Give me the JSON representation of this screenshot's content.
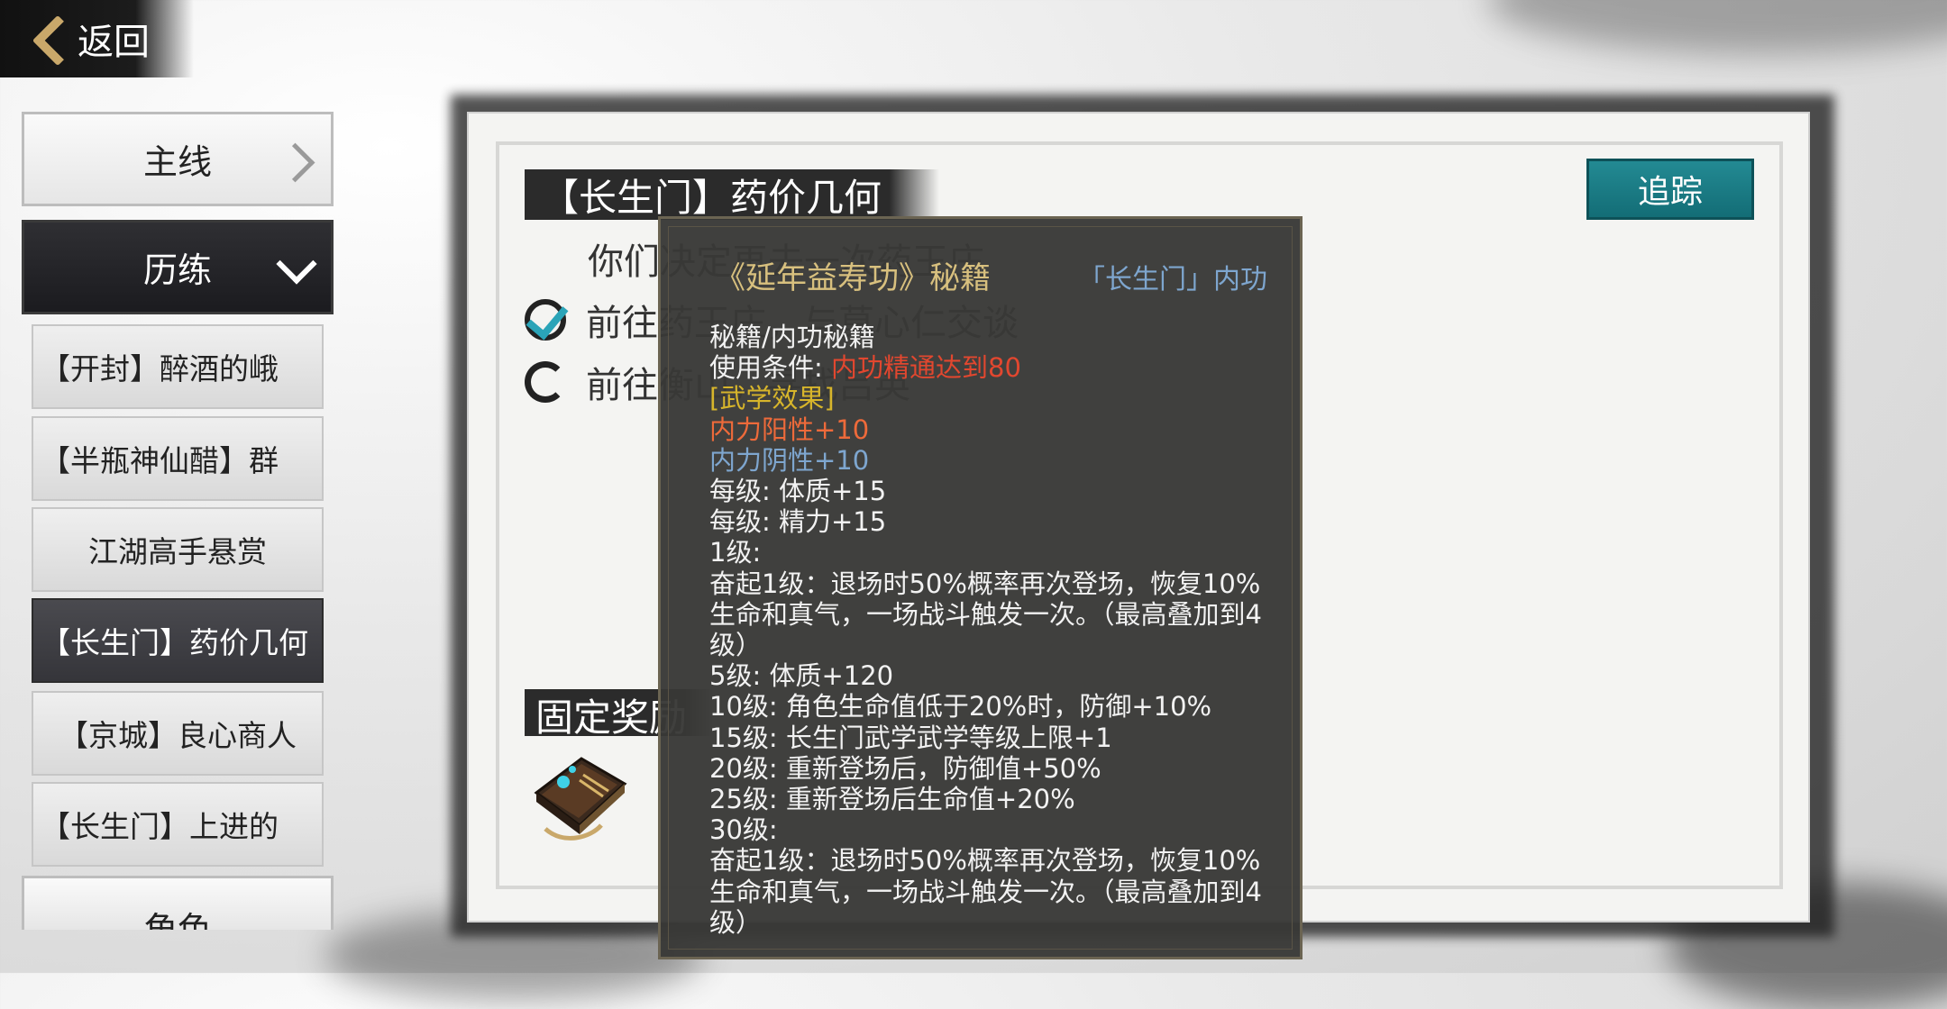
{
  "header": {
    "back_label": "返回"
  },
  "sidebar": {
    "main_line": "主线",
    "training": "历练",
    "quests": [
      "【开封】醉酒的峨",
      "【半瓶神仙醋】群",
      "江湖高手悬赏",
      "【长生门】药价几何",
      "【京城】良心商人",
      "【长生门】上进的"
    ],
    "role": "角色"
  },
  "quest": {
    "title": "【长生门】药价几何",
    "track_label": "追踪",
    "description": "你们决定再去一次药王庄",
    "objectives": [
      {
        "text": "前往药王庄，与莫心仁交谈",
        "done": true
      },
      {
        "text": "前往衡山，寻找吕英",
        "done": false
      }
    ],
    "reward_title": "固定奖励"
  },
  "tooltip": {
    "name": "《延年益寿功》秘籍",
    "type": "「长生门」内功",
    "category": "秘籍/内功秘籍",
    "condition_label": "使用条件: ",
    "condition_value": "内功精通达到80",
    "effect_header": "[武学效果]",
    "yang": "内力阳性+10",
    "yin": "内力阴性+10",
    "per_level_1": "每级: 体质+15",
    "per_level_2": "每级: 精力+15",
    "lv1": "1级:",
    "lv1_desc": "奋起1级：退场时50%概率再次登场，恢复10%生命和真气，一场战斗触发一次。（最高叠加到4级）",
    "lv5": "5级: 体质+120",
    "lv10": "10级: 角色生命值低于20%时，防御+10%",
    "lv15": "15级: 长生门武学武学等级上限+1",
    "lv20": "20级: 重新登场后，防御值+50%",
    "lv25": "25级: 重新登场后生命值+20%",
    "lv30": "30级:",
    "lv30_desc": "奋起1级：退场时50%概率再次登场，恢复10%生命和真气，一场战斗触发一次。（最高叠加到4级）"
  },
  "colors": {
    "accent_teal": "#1d7f89",
    "tooltip_title": "#d8c07e",
    "condition_red": "#e2472f",
    "effect_yellow": "#d7b52b",
    "yang_orange": "#ee6a3a",
    "yin_blue": "#7ea6cf"
  },
  "icons": {
    "back": "chevron-left-icon",
    "done": "checkmark-icon",
    "pending": "loading-ring-icon",
    "reward": "martial-manual-book-icon"
  }
}
